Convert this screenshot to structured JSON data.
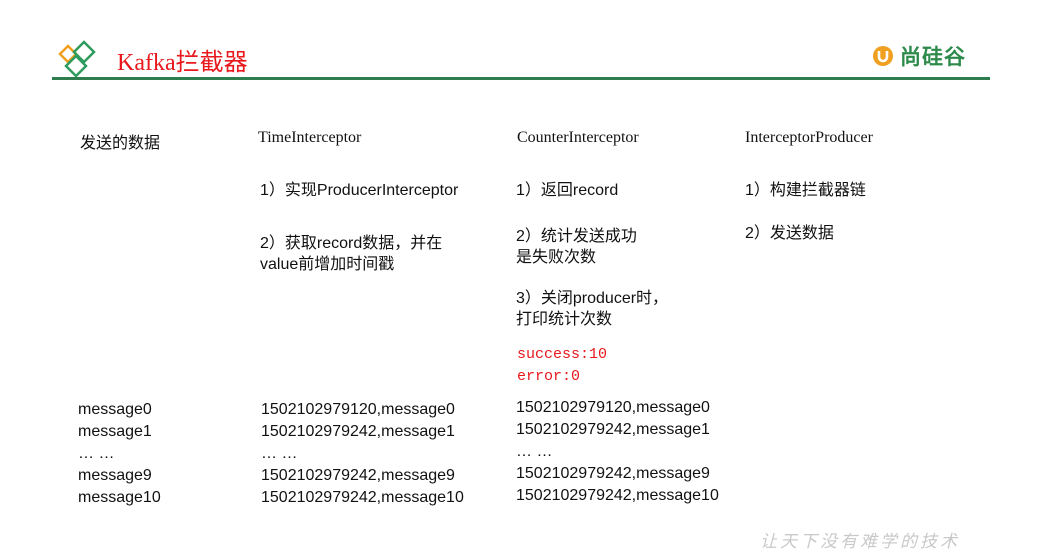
{
  "title": "Kafka拦截器",
  "brand": {
    "name": "尚硅谷"
  },
  "colors": {
    "title": "#e8181c",
    "rule": "#2e7d4e",
    "brand": "#2d8a4a",
    "stats": "#e8181c"
  },
  "columns": {
    "data": {
      "header": "发送的数据",
      "messages": [
        "message0",
        "message1",
        "… …",
        "message9",
        "message10"
      ]
    },
    "time": {
      "header": "TimeInterceptor",
      "step1": "1）实现ProducerInterceptor",
      "step2_line1": "2）获取record数据，并在",
      "step2_line2": "value前增加时间戳",
      "messages": [
        "1502102979120,message0",
        "1502102979242,message1",
        "… …",
        "1502102979242,message9",
        "1502102979242,message10"
      ]
    },
    "counter": {
      "header": "CounterInterceptor",
      "step1": "1）返回record",
      "step2_line1": "2）统计发送成功",
      "step2_line2": "是失败次数",
      "step3_line1": "3）关闭producer时，",
      "step3_line2": "打印统计次数",
      "success": "success:10",
      "error": "error:0",
      "messages": [
        "1502102979120,message0",
        "1502102979242,message1",
        "… …",
        "1502102979242,message9",
        "1502102979242,message10"
      ]
    },
    "producer": {
      "header": "InterceptorProducer",
      "step1": "1）构建拦截器链",
      "step2": "2）发送数据"
    }
  },
  "watermark": "让天下没有难学的技术"
}
